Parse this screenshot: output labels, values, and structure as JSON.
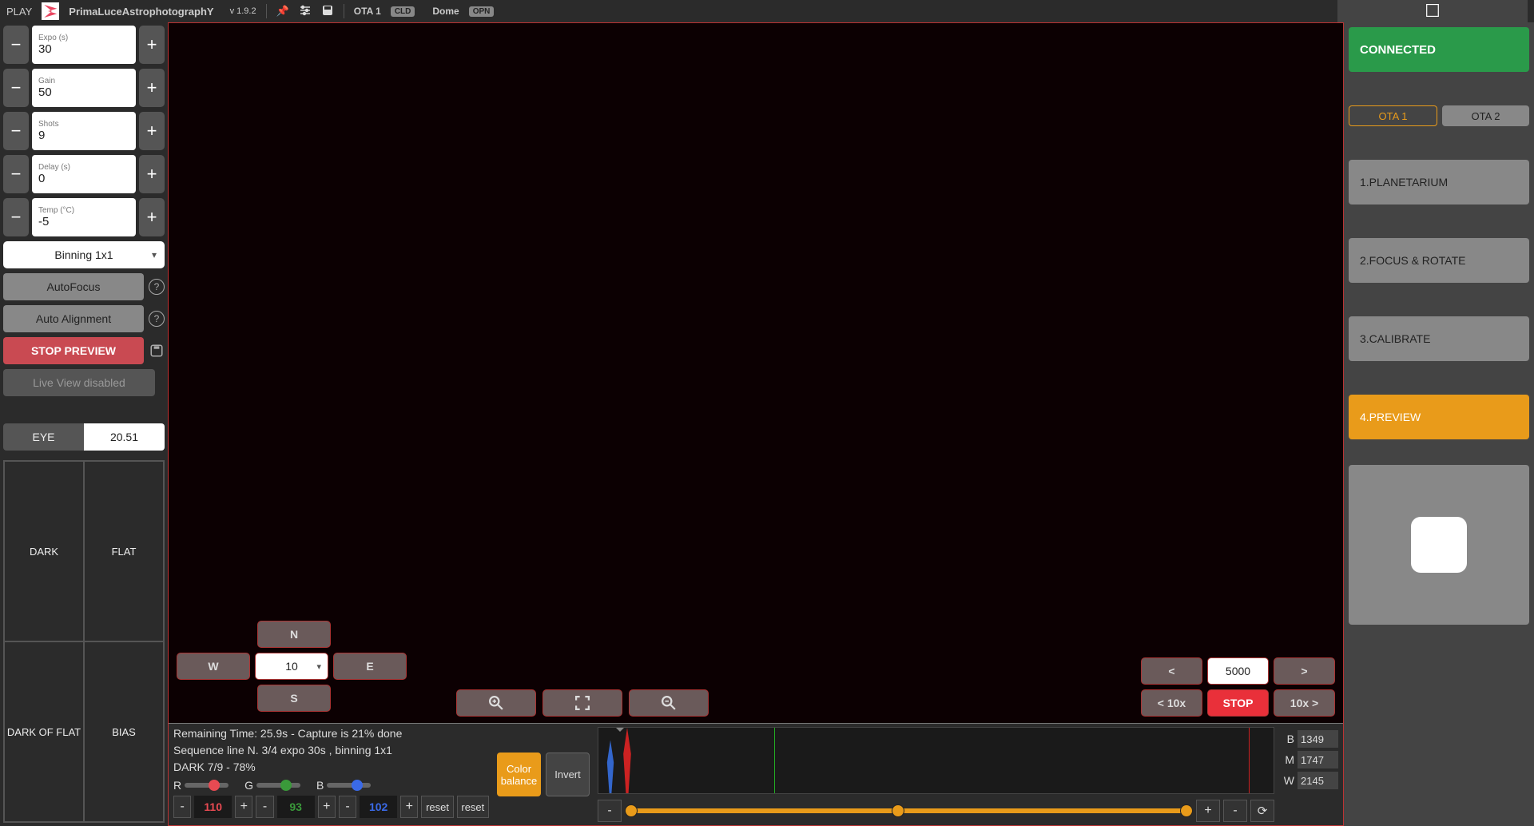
{
  "titlebar": {
    "app_prefix": "PLAY",
    "app_name": "PrimaLuceAstrophotographY",
    "version": "v 1.9.2",
    "ota_label": "OTA 1",
    "ota_badge": "CLD",
    "dome_label": "Dome",
    "dome_badge": "OPN"
  },
  "left": {
    "expo": {
      "label": "Expo (s)",
      "value": "30"
    },
    "gain": {
      "label": "Gain",
      "value": "50"
    },
    "shots": {
      "label": "Shots",
      "value": "9"
    },
    "delay": {
      "label": "Delay (s)",
      "value": "0"
    },
    "temp": {
      "label": "Temp (°C)",
      "value": "-5"
    },
    "binning": "Binning 1x1",
    "autofocus": "AutoFocus",
    "auto_align": "Auto Alignment",
    "stop_preview": "STOP PREVIEW",
    "live_view": "Live View disabled",
    "eye_label": "EYE",
    "eye_value": "20.51",
    "grid": {
      "dark": "DARK",
      "flat": "FLAT",
      "dark_of_flat": "DARK OF FLAT",
      "bias": "BIAS"
    }
  },
  "preview": {
    "dir": {
      "n": "N",
      "s": "S",
      "e": "E",
      "w": "W",
      "speed": "10"
    },
    "focus": {
      "lt": "<",
      "gt": ">",
      "value": "5000",
      "lt10": "< 10x",
      "stop": "STOP",
      "gt10": "10x >"
    }
  },
  "status": {
    "remaining": "Remaining Time: 25.9s  -  Capture is 21% done",
    "sequence": "Sequence line N. 3/4 expo 30s , binning 1x1",
    "progress": "DARK 7/9 - 78%",
    "r_label": "R",
    "g_label": "G",
    "b_label": "B",
    "r": "110",
    "g": "93",
    "b": "102",
    "reset": "reset",
    "color_balance": "Color balance",
    "invert": "Invert",
    "stats": {
      "b": "1349",
      "m": "1747",
      "w": "2145"
    },
    "stat_labels": {
      "b": "B",
      "m": "M",
      "w": "W"
    },
    "minus": "-",
    "plus": "+"
  },
  "right": {
    "connected": "CONNECTED",
    "ota1": "OTA 1",
    "ota2": "OTA 2",
    "nav": {
      "planetarium": "1.PLANETARIUM",
      "focus": "2.FOCUS & ROTATE",
      "calibrate": "3.CALIBRATE",
      "preview": "4.PREVIEW"
    }
  }
}
